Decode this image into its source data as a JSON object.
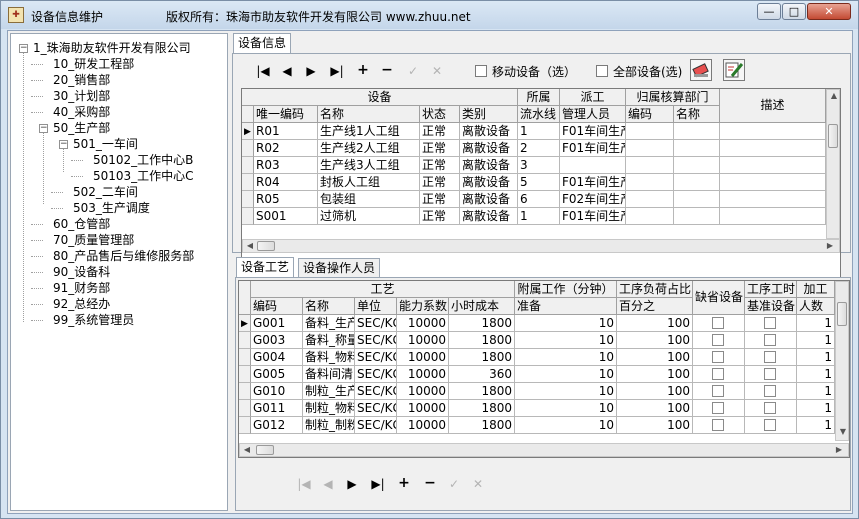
{
  "window": {
    "title": "设备信息维护",
    "copyright": "版权所有：珠海市助友软件开发有限公司 www.zhuu.net",
    "minimize": "—",
    "maximize": "□",
    "close": "✕"
  },
  "tree": {
    "nodes": [
      {
        "label": "1_珠海助友软件开发有限公司",
        "box": "−"
      },
      {
        "label": "10_研发工程部"
      },
      {
        "label": "20_销售部"
      },
      {
        "label": "30_计划部"
      },
      {
        "label": "40_采购部"
      },
      {
        "label": "50_生产部",
        "box": "−"
      },
      {
        "label": "501_一车间",
        "box": "−"
      },
      {
        "label": "50102_工作中心B"
      },
      {
        "label": "50103_工作中心C"
      },
      {
        "label": "502_二车间"
      },
      {
        "label": "503_生产调度"
      },
      {
        "label": "60_仓管部"
      },
      {
        "label": "70_质量管理部"
      },
      {
        "label": "80_产品售后与维修服务部"
      },
      {
        "label": "90_设备科"
      },
      {
        "label": "91_财务部"
      },
      {
        "label": "92_总经办"
      },
      {
        "label": "99_系统管理员"
      }
    ]
  },
  "tabs_top": [
    {
      "label": "设备信息"
    }
  ],
  "nav_top": {
    "first": "|◀",
    "prev": "◀",
    "next": "▶",
    "last": "▶|",
    "add": "+",
    "delete": "−",
    "post": "✓",
    "cancel": "✕"
  },
  "filters": {
    "mobile_label": "移动设备（选）",
    "all_label": "全部设备(选)"
  },
  "equipment": {
    "groups": [
      "设备",
      "所属",
      "派工",
      "归属核算部门",
      "描述"
    ],
    "columns": [
      "唯一编码",
      "名称",
      "状态",
      "类别",
      "流水线",
      "管理人员",
      "编码",
      "名称"
    ],
    "rows": [
      [
        "R01",
        "生产线1人工组",
        "正常",
        "离散设备",
        "1",
        "F01车间生产"
      ],
      [
        "R02",
        "生产线2人工组",
        "正常",
        "离散设备",
        "2",
        "F01车间生产"
      ],
      [
        "R03",
        "生产线3人工组",
        "正常",
        "离散设备",
        "3",
        ""
      ],
      [
        "R04",
        "封板人工组",
        "正常",
        "离散设备",
        "5",
        "F01车间生产"
      ],
      [
        "R05",
        "包装组",
        "正常",
        "离散设备",
        "6",
        "F02车间生产"
      ],
      [
        "S001",
        "过筛机",
        "正常",
        "离散设备",
        "1",
        "F01车间生产"
      ]
    ],
    "current_row": 0
  },
  "tabs_bottom": [
    {
      "label": "设备工艺"
    },
    {
      "label": "设备操作人员"
    }
  ],
  "process": {
    "groups": [
      "工艺",
      "附属工作（分钟）",
      "工序负荷占比",
      "缺省设备",
      "工序工时",
      "加工"
    ],
    "columns": [
      "编码",
      "名称",
      "单位",
      "能力系数",
      "小时成本",
      "准备",
      "百分之",
      "基准设备",
      "人数"
    ],
    "rows": [
      [
        "G001",
        "备料_生产",
        "SEC/KG",
        "10000",
        "1800",
        "10",
        "100",
        "1"
      ],
      [
        "G003",
        "备料_称量",
        "SEC/KG",
        "10000",
        "1800",
        "10",
        "100",
        "1"
      ],
      [
        "G004",
        "备料_物料",
        "SEC/KG",
        "10000",
        "1800",
        "10",
        "100",
        "1"
      ],
      [
        "G005",
        "备料间清",
        "SEC/KG",
        "10000",
        "360",
        "10",
        "100",
        "1"
      ],
      [
        "G010",
        "制粒_生产",
        "SEC/KG",
        "10000",
        "1800",
        "10",
        "100",
        "1"
      ],
      [
        "G011",
        "制粒_物料",
        "SEC/KG",
        "10000",
        "1800",
        "10",
        "100",
        "1"
      ],
      [
        "G012",
        "制粒_制粉",
        "SEC/KG",
        "10000",
        "1800",
        "10",
        "100",
        "1"
      ]
    ],
    "current_row": 0
  },
  "nav_bottom": {
    "first": "|◀",
    "prev": "◀",
    "next": "▶",
    "last": "▶|",
    "add": "+",
    "delete": "−",
    "post": "✓",
    "cancel": "✕"
  },
  "icons": {
    "eraser": "eraser-icon",
    "edit": "edit-pencil-icon"
  }
}
